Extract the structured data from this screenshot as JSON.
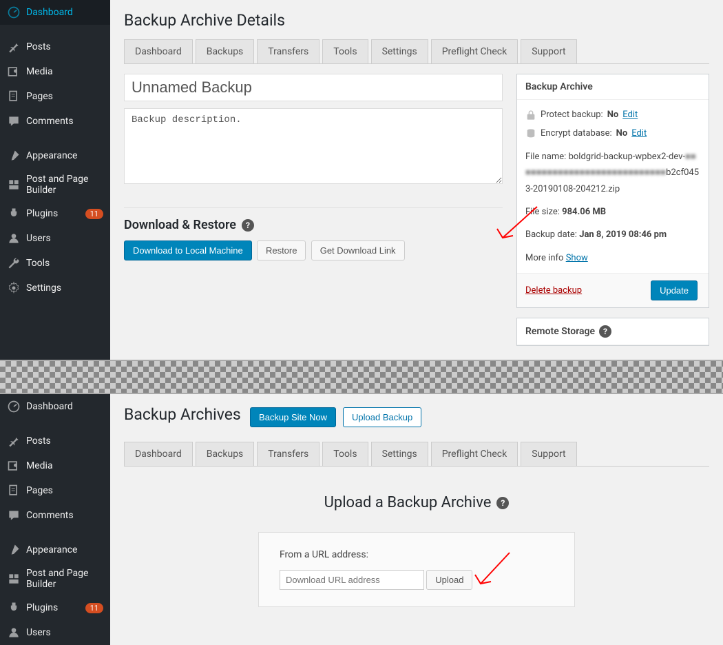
{
  "sidebar": {
    "items": [
      {
        "label": "Dashboard",
        "icon": "dashboard"
      },
      {
        "label": "Posts",
        "icon": "pin",
        "sep_before": true
      },
      {
        "label": "Media",
        "icon": "media"
      },
      {
        "label": "Pages",
        "icon": "page"
      },
      {
        "label": "Comments",
        "icon": "comment"
      },
      {
        "label": "Appearance",
        "icon": "brush",
        "sep_before": true
      },
      {
        "label": "Post and Page Builder",
        "icon": "builder"
      },
      {
        "label": "Plugins",
        "icon": "plug",
        "badge": "11"
      },
      {
        "label": "Users",
        "icon": "user"
      },
      {
        "label": "Tools",
        "icon": "wrench"
      },
      {
        "label": "Settings",
        "icon": "gear"
      }
    ]
  },
  "panel1": {
    "title": "Backup Archive Details",
    "tabs": [
      "Dashboard",
      "Backups",
      "Transfers",
      "Tools",
      "Settings",
      "Preflight Check",
      "Support"
    ],
    "backup_title": "Unnamed Backup",
    "backup_desc": "Backup description.",
    "download_restore_heading": "Download & Restore",
    "download_btn": "Download to Local Machine",
    "restore_btn": "Restore",
    "getlink_btn": "Get Download Link",
    "archive_box": {
      "header": "Backup Archive",
      "protect_label": "Protect backup:",
      "protect_value": "No",
      "edit": "Edit",
      "encrypt_label": "Encrypt database:",
      "encrypt_value": "No",
      "filename_label": "File name:",
      "filename1": "boldgrid-backup-wpbex2-dev-",
      "filename_blur": "■■■■■■■■■■■■■■■■■■■■■■■■■■■■",
      "filename2": "b2cf0453-20190108-204212.zip",
      "filesize_label": "File size:",
      "filesize_value": "984.06 MB",
      "date_label": "Backup date:",
      "date_value": "Jan 8, 2019 08:46 pm",
      "moreinfo_label": "More info",
      "show": "Show",
      "delete": "Delete backup",
      "update": "Update"
    },
    "remote_box_header": "Remote Storage"
  },
  "panel2": {
    "title": "Backup Archives",
    "backup_now_btn": "Backup Site Now",
    "upload_backup_btn": "Upload Backup",
    "tabs": [
      "Dashboard",
      "Backups",
      "Transfers",
      "Tools",
      "Settings",
      "Preflight Check",
      "Support"
    ],
    "upload_heading": "Upload a Backup Archive",
    "from_url_label": "From a URL address:",
    "url_placeholder": "Download URL address",
    "upload_btn": "Upload"
  },
  "sidebar2": {
    "items": [
      {
        "label": "Dashboard",
        "icon": "dashboard"
      },
      {
        "label": "Posts",
        "icon": "pin",
        "sep_before": true
      },
      {
        "label": "Media",
        "icon": "media"
      },
      {
        "label": "Pages",
        "icon": "page"
      },
      {
        "label": "Comments",
        "icon": "comment"
      },
      {
        "label": "Appearance",
        "icon": "brush",
        "sep_before": true
      },
      {
        "label": "Post and Page Builder",
        "icon": "builder"
      },
      {
        "label": "Plugins",
        "icon": "plug",
        "badge": "11"
      },
      {
        "label": "Users",
        "icon": "user"
      }
    ]
  }
}
